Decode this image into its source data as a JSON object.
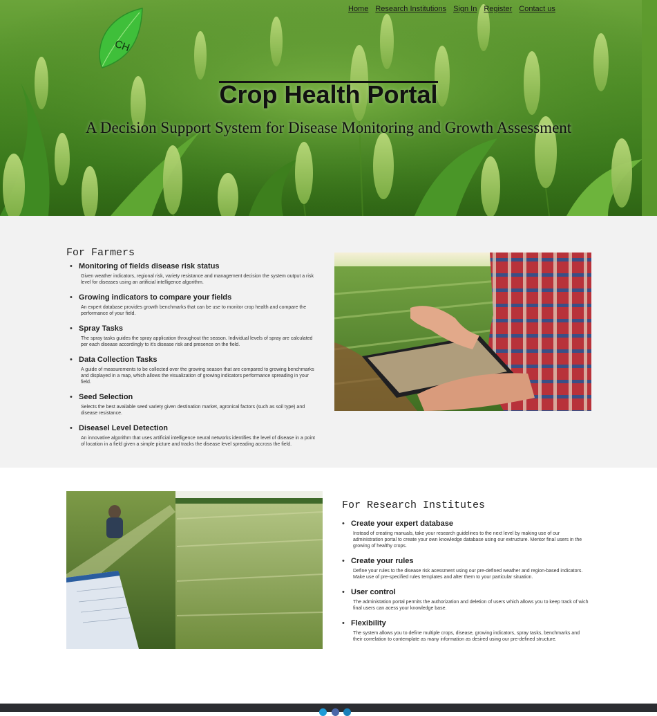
{
  "nav": {
    "items": [
      "Home",
      "Research Institutions",
      "Sign In",
      "Register",
      "Contact us"
    ]
  },
  "logo": {
    "text": "CH",
    "color": "#3fbf3a"
  },
  "hero": {
    "title": "Crop Health Portal",
    "subtitle": "A Decision Support System for Disease Monitoring and Growth Assessment"
  },
  "farmers": {
    "heading": "For Farmers",
    "items": [
      {
        "title": "Monitoring of fields disease risk status",
        "desc": "Given weather indicators, regional risk, variety resistance and management decision the system output a risk level for diseases using an artificial intelligence algorithm."
      },
      {
        "title": "Growing indicators to compare your fields",
        "desc": "An expert database provides growth benchmarks that can be use to monitor crop health and compare the performance of your field."
      },
      {
        "title": "Spray Tasks",
        "desc": "The spray tasks guides the spray application throughout the season. Individual levels of spray are calculated per each disease accordingly to it's disease risk and presence on the field."
      },
      {
        "title": "Data Collection Tasks",
        "desc": "A guide of measurements to be collected over the growing season that are compared to growing benchmarks and displayed in a map, which allows the visualization of growing indicators performance spreading in your field."
      },
      {
        "title": "Seed Selection",
        "desc": "Selects the best available seed variety given destination market, agronical factors (such as soil type) and disease resistance."
      },
      {
        "title": "Diseasel Level Detection",
        "desc": "An innovative algorithm that uses artificial intelligence neural networks identifies the level of disease in a point of location in a field given a simple picture and tracks the disease level spreading accross the field."
      }
    ]
  },
  "research": {
    "heading": "For Research Institutes",
    "items": [
      {
        "title": "Create your expert database",
        "desc": "Instead of creating manuals, take your research guidelines to the next level by making use of our administration portal to create your own knowledge database using our extructure. Mentor final users in the growing of healthy crops."
      },
      {
        "title": "Create your rules",
        "desc": "Define your rules to the disease risk acessment using our pre-defined weather and region-based indicators. Make use of pre-specified rules templates and alter them to your particular situation."
      },
      {
        "title": "User control",
        "desc": "The administation portal permits the authorization and deletion of users which allows you to keep track of wich final users can acess your knowledge base."
      },
      {
        "title": "Flexibility",
        "desc": "The system allows you to define multiple crops, disease, growing indicators, spray tasks, benchmarks and their correlation to contemplate as many information as desired using our pre-defined structure."
      }
    ]
  },
  "colors": {
    "hero_green": "#4f8f27",
    "section_gray": "#f2f2f2",
    "footer": "#2b2d31",
    "social": [
      "#1e9bd7",
      "#4a67a8",
      "#1b80b8"
    ]
  }
}
